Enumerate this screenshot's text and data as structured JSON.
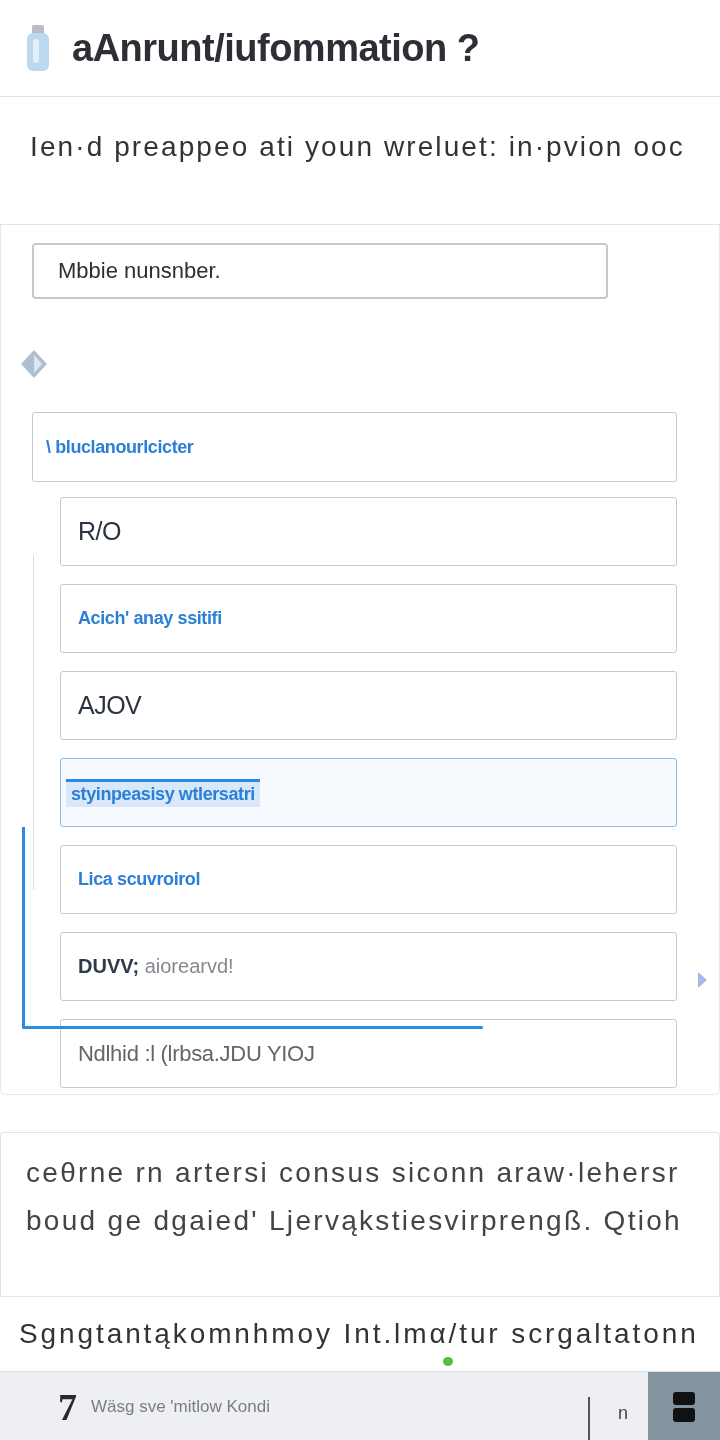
{
  "header": {
    "title": "aAnrunt/iufommation ?"
  },
  "intro": {
    "text": "Ien·d preappeo ati youn wreluet: in·pvion ooc"
  },
  "form": {
    "mobile_field": {
      "placeholder": "Mbbie nunsnber."
    },
    "options": [
      {
        "label": "\\ bluclanourlcicter",
        "kind": "link",
        "selected": false,
        "children": [
          {
            "label": "R/O",
            "kind": "value",
            "selected": false
          },
          {
            "label": "Acich' anay ssitifi",
            "kind": "link",
            "selected": false
          },
          {
            "label": "AJOV",
            "kind": "value",
            "selected": false
          },
          {
            "label": "styinpeasisy wtlersatri",
            "kind": "link",
            "selected": true
          },
          {
            "label": "Lica scuvroirol",
            "kind": "link",
            "selected": false
          },
          {
            "label": "**DUVV;** aiorearvd!",
            "kind": "detail",
            "selected": false
          },
          {
            "label": "Ndlhid :l (lrbsa.JDU YIOJ",
            "kind": "faded",
            "selected": false
          }
        ]
      }
    ]
  },
  "notes": {
    "lines": [
      "ceθrne rn artersi consus siconn araw·lehersr",
      "boud ge dgaied' Ljervąkstiesvirprengß. Qtioh"
    ]
  },
  "footer_note": {
    "text": "Sgngtantąkomnhmoy Int.lmα/tur scrgaltatonn"
  },
  "bottom_bar": {
    "symbol": "7",
    "label": "Wäsg sve 'mitlow Kondi",
    "tab": "n"
  }
}
